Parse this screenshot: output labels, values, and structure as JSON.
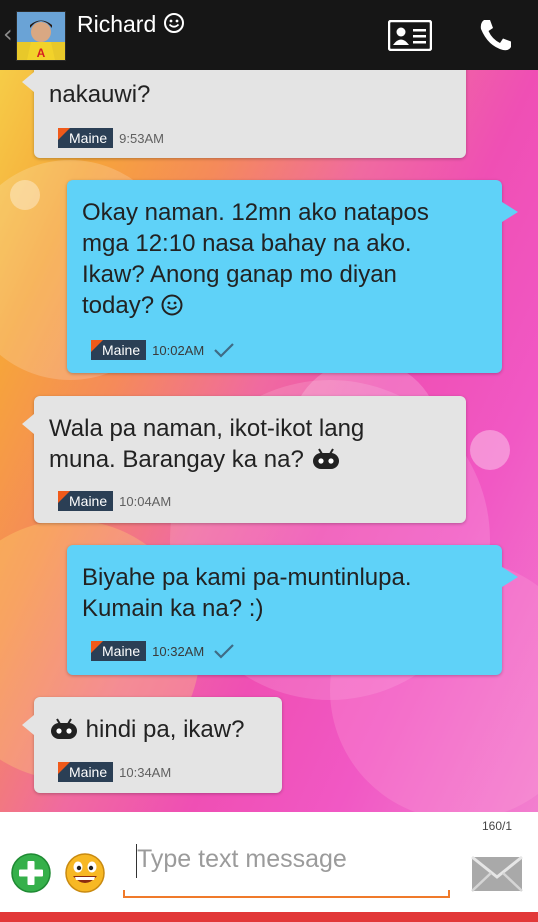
{
  "header": {
    "contact_name": "Richard",
    "avatar_icon": "contact-photo",
    "contact_card_icon": "contact-card-icon",
    "call_icon": "phone-icon"
  },
  "messages": [
    {
      "direction": "incoming",
      "lines": [
        "nakauwi?"
      ],
      "sender_tag": "Maine",
      "time": "9:53AM"
    },
    {
      "direction": "outgoing",
      "lines": [
        "Okay naman. 12mn ako natapos",
        "mga 12:10 nasa bahay na ako.",
        "Ikaw? Anong ganap mo diyan",
        "today?"
      ],
      "sender_tag": "Maine",
      "time": "10:02AM"
    },
    {
      "direction": "incoming",
      "lines": [
        "Wala pa naman, ikot-ikot lang",
        "muna. Barangay ka na?"
      ],
      "sender_tag": "Maine",
      "time": "10:04AM"
    },
    {
      "direction": "outgoing",
      "lines": [
        "Biyahe pa kami pa-muntinlupa.",
        "Kumain ka na? :)"
      ],
      "sender_tag": "Maine",
      "time": "10:32AM"
    },
    {
      "direction": "incoming",
      "lines": [
        "hindi pa, ikaw?"
      ],
      "sender_tag": "Maine",
      "time": "10:34AM"
    }
  ],
  "composer": {
    "counter": "160/1",
    "placeholder": "Type text message",
    "add_icon": "plus-icon",
    "emoji_icon": "emoji-icon",
    "send_icon": "envelope-icon"
  },
  "colors": {
    "incoming_bubble": "#e4e4e4",
    "outgoing_bubble": "#5fd2f8",
    "tag_background": "#2b3f55",
    "tag_accent": "#f05a1a",
    "input_underline": "#f07a2a"
  }
}
